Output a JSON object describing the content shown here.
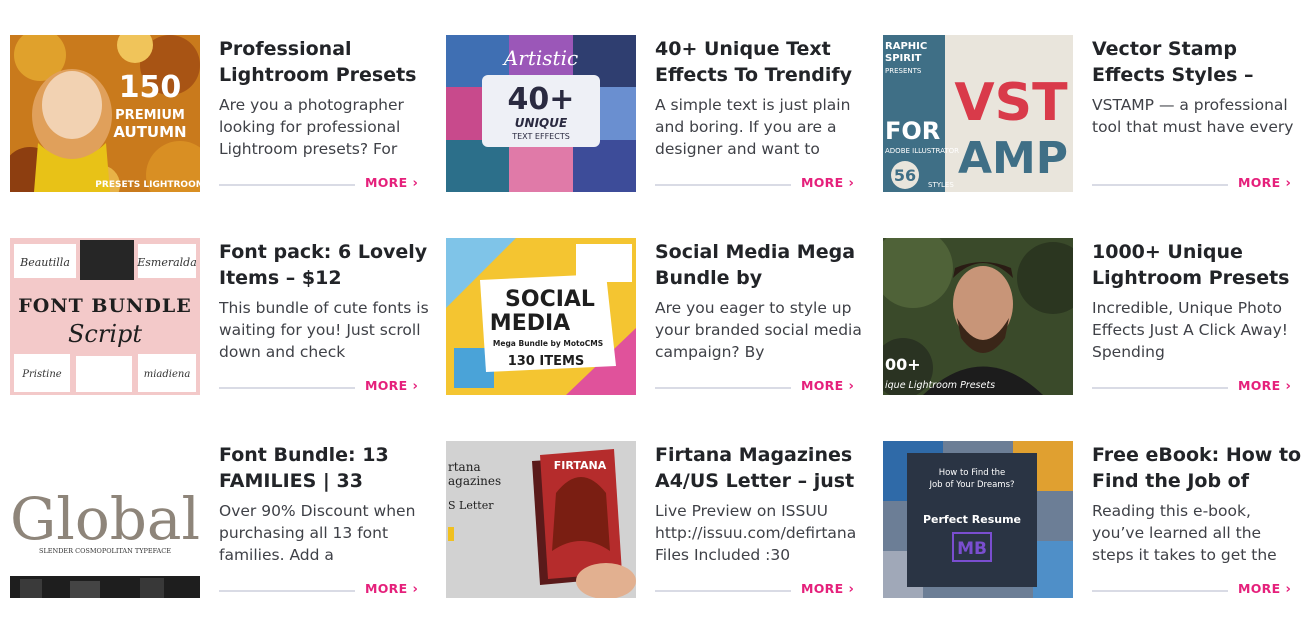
{
  "more_label": "MORE",
  "more_chevron": "›",
  "accent_color": "#e5207b",
  "cards": [
    {
      "title": "Professional Lightroom Presets",
      "excerpt": "Are you a photographer looking for professional Lightroom presets? For",
      "thumb": {
        "icon": "autumn-portrait-thumbnail",
        "l1": "150",
        "l2": "PREMIUM",
        "l3": "AUTUMN",
        "l4": "PRESETS LIGHTROOM"
      }
    },
    {
      "title": "40+ Unique Text Effects To Trendify",
      "excerpt": "A simple text is just plain and boring. If you are a designer and want to",
      "thumb": {
        "icon": "text-effects-thumbnail",
        "l1": "40+",
        "l2": "UNIQUE",
        "l3": "TEXT EFFECTS",
        "l4": "Artistic"
      }
    },
    {
      "title": "Vector Stamp Effects Styles –",
      "excerpt": "VSTAMP — a professional tool that must have every",
      "thumb": {
        "icon": "vector-stamp-thumbnail",
        "l1": "RAPHIC",
        "l2": "SPIRIT",
        "l3": "PRESENTS",
        "l4": "VST",
        "l5": "AMP",
        "l6": "56",
        "l7": "STYLES",
        "l8": "FOR",
        "l9": "ADOBE ILLUSTRATOR"
      }
    },
    {
      "title": "Font pack: 6 Lovely Items – $12",
      "excerpt": "This bundle of cute fonts is waiting for you! Just scroll down and check",
      "thumb": {
        "icon": "font-bundle-thumbnail",
        "l1": "FONT BUNDLE",
        "l2": "Script",
        "l3": "Beautilla",
        "l4": "Esmeralda",
        "l5": "Pristine",
        "l6": "miadiena"
      }
    },
    {
      "title": "Social Media Mega Bundle by",
      "excerpt": "Are you eager to style up your branded social media campaign? By",
      "thumb": {
        "icon": "social-media-thumbnail",
        "l1": "SOCIAL",
        "l2": "MEDIA",
        "l3": "Mega Bundle by MotoCMS",
        "l4": "130 ITEMS"
      }
    },
    {
      "title": "1000+ Unique Lightroom Presets",
      "excerpt": "Incredible, Unique Photo Effects Just A Click Away! Spending",
      "thumb": {
        "icon": "bearded-man-thumbnail",
        "l1": "00+",
        "l2": "ique Lightroom Presets"
      }
    },
    {
      "title": "Font Bundle: 13 FAMILIES | 33",
      "excerpt": "Over 90% Discount when purchasing all 13 font families. Add a",
      "thumb": {
        "icon": "global-font-thumbnail",
        "l1": "Global",
        "l2": "SLENDER COSMOPOLITAN TYPEFACE"
      }
    },
    {
      "title": "Firtana Magazines A4/US Letter – just",
      "excerpt": "Live Preview on ISSUU http://issuu.com/defirtana Files Included :30",
      "thumb": {
        "icon": "magazine-thumbnail",
        "l1": "rtana",
        "l2": "agazines",
        "l3": "S Letter",
        "l4": "FIRTANA"
      }
    },
    {
      "title": "Free eBook: How to Find the Job of",
      "excerpt": "Reading this e-book, you’ve learned all the steps it takes to get the",
      "thumb": {
        "icon": "ebook-thumbnail",
        "l1": "How to Find the",
        "l2": "Job of Your Dreams?",
        "l3": "Perfect Resume",
        "l4": "MB"
      }
    }
  ]
}
